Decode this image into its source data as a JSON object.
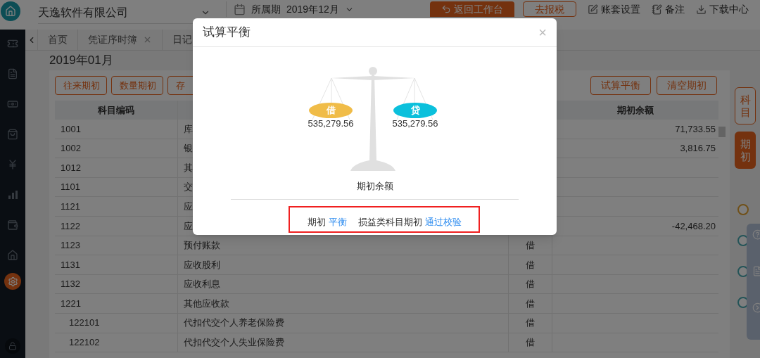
{
  "header": {
    "company": "天逸软件有限公司",
    "period_label": "所属期",
    "period": "2019年12月",
    "buttons": [
      {
        "label": "返回工作台",
        "kind": "primary"
      },
      {
        "label": "去报税",
        "kind": "outline"
      },
      {
        "label": "账套设置",
        "kind": "edit"
      },
      {
        "label": "备注",
        "kind": "note"
      },
      {
        "label": "下载中心",
        "kind": "download"
      }
    ]
  },
  "tabs": [
    {
      "label": "首页",
      "closable": false
    },
    {
      "label": "凭证序时簿",
      "closable": true
    },
    {
      "label": "日记",
      "closable": false
    }
  ],
  "page_title": "2019年01月",
  "toolbar_left": [
    "往来期初",
    "数量期初",
    "存"
  ],
  "toolbar_right": [
    "试算平衡",
    "清空期初"
  ],
  "table": {
    "columns": [
      "科目编码",
      "期初余额"
    ],
    "rows": [
      {
        "code": "1001",
        "name": "库",
        "balance": "71,733.55"
      },
      {
        "code": "1002",
        "name": "银",
        "balance": "3,816.75"
      },
      {
        "code": "1012",
        "name": "其"
      },
      {
        "code": "1101",
        "name": "交"
      },
      {
        "code": "1121",
        "name": "应"
      },
      {
        "code": "1122",
        "name": "应",
        "balance": "-42,468.20"
      },
      {
        "code": "1123",
        "name": "预付账款",
        "direction": "借"
      },
      {
        "code": "1131",
        "name": "应收股利",
        "direction": "借"
      },
      {
        "code": "1132",
        "name": "应收利息",
        "direction": "借"
      },
      {
        "code": "1221",
        "name": "其他应收款",
        "direction": "借",
        "children": [
          {
            "code": "122101",
            "name": "代扣代交个人养老保险费",
            "direction": "借"
          },
          {
            "code": "122102",
            "name": "代扣代交个人失业保险费",
            "direction": "借"
          }
        ]
      }
    ]
  },
  "side_tabs": [
    {
      "label": "科目",
      "selected": false
    },
    {
      "label": "期初",
      "selected": true
    }
  ],
  "float_panel": [
    {
      "kind": "help"
    },
    {
      "kind": "doc"
    },
    {
      "kind": "hide"
    }
  ],
  "dialog": {
    "title": "试算平衡",
    "close": "×",
    "pans": [
      {
        "label": "借",
        "amount": "535,279.56",
        "color": "#f0bc48"
      },
      {
        "label": "贷",
        "amount": "535,279.56",
        "color": "#0bc0dc"
      }
    ],
    "caption": "期初余额",
    "checks": [
      {
        "label": "期初",
        "result": "平衡"
      },
      {
        "label": "损益类科目期初",
        "result": "通过校验"
      }
    ]
  }
}
